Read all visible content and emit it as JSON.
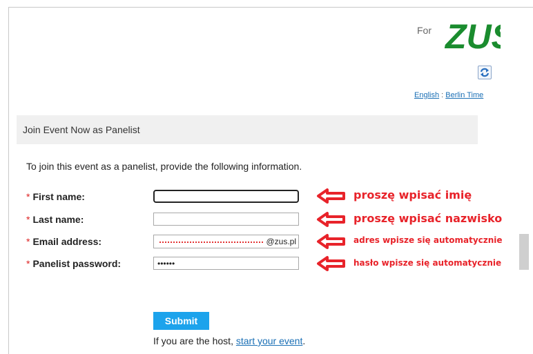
{
  "header": {
    "for_text": "For",
    "logo_text": "ZUS",
    "refresh_icon": "refresh-icon",
    "lang": {
      "language": "English",
      "separator": " : ",
      "timezone": "Berlin Time"
    }
  },
  "section": {
    "title": "Join Event Now as Panelist"
  },
  "intro": "To join this event as a panelist, provide the following information.",
  "form": {
    "required_mark": "*",
    "first_name": {
      "label": "First name:",
      "value": ""
    },
    "last_name": {
      "label": "Last name:",
      "value": ""
    },
    "email": {
      "label": "Email address:",
      "suffix": "@zus.pl"
    },
    "password": {
      "label": "Panelist password:",
      "value": "••••••"
    }
  },
  "annotations": {
    "arrow_icon": "left-arrow-icon",
    "color": "#e8232a",
    "first_name": "proszę wpisać imię",
    "last_name": "proszę wpisać nazwisko",
    "email": "adres wpisze się automatycznie",
    "password": "hasło wpisze się automatycznie"
  },
  "actions": {
    "submit_label": "Submit",
    "host_text": "If you are the host, ",
    "host_link": "start your event",
    "host_end": "."
  },
  "colors": {
    "logo_green": "#1a8c2e",
    "submit_blue": "#1ca3ec",
    "link_blue": "#1a6fb5"
  }
}
